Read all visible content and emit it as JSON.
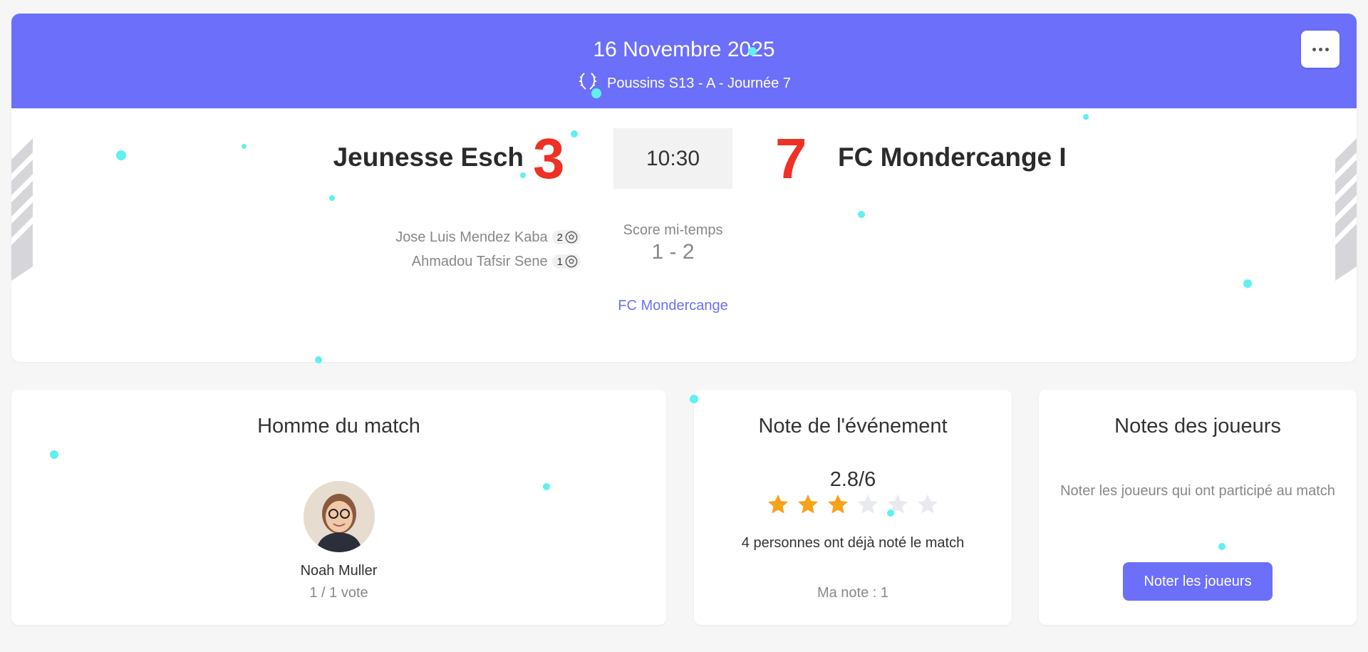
{
  "header": {
    "date": "16 Novembre 2025",
    "competition": "Poussins S13 - A - Journée 7",
    "icon": "laurel-icon",
    "more_icon": "more-icon"
  },
  "match": {
    "home_team": "Jeunesse Esch",
    "home_score": "3",
    "kickoff": "10:30",
    "away_score": "7",
    "away_team": "FC Mondercange I",
    "scorers": [
      {
        "name": "Jose Luis Mendez Kaba",
        "goals": "2"
      },
      {
        "name": "Ahmadou Tafsir Sene",
        "goals": "1"
      }
    ],
    "halftime_label": "Score mi-temps",
    "halftime_score": "1 - 2",
    "venue_link": "FC Mondercange"
  },
  "motm": {
    "title": "Homme du match",
    "name": "Noah Muller",
    "votes": "1 / 1 vote"
  },
  "rating": {
    "title": "Note de l'événement",
    "value": "2.8/6",
    "stars_filled": 3,
    "stars_total": 6,
    "count_text": "4 personnes ont déjà noté le match",
    "my_rating": "Ma note : 1"
  },
  "players": {
    "title": "Notes des joueurs",
    "text": "Noter les joueurs qui ont participé au match",
    "button": "Noter les joueurs"
  },
  "colors": {
    "accent": "#6c6ff9",
    "score": "#ee3124",
    "star_filled": "#f7a21b",
    "star_empty": "#e8eaee"
  }
}
